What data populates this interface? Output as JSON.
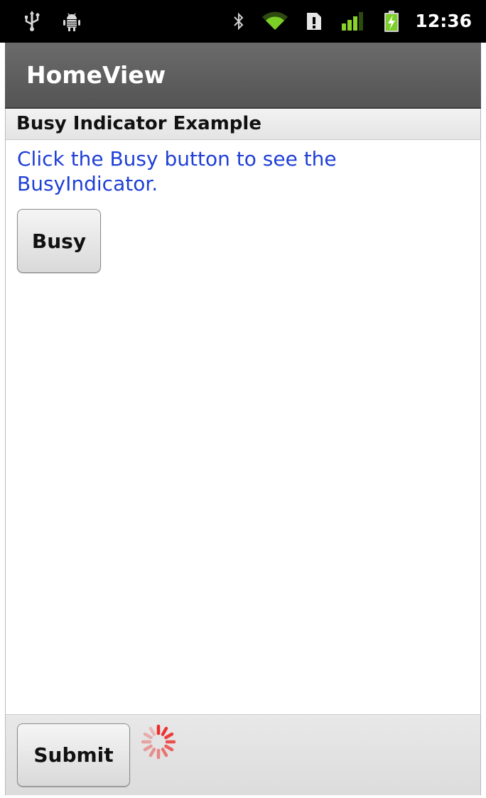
{
  "status_bar": {
    "time": "12:36",
    "icons": [
      "usb-icon",
      "android-debug-icon",
      "bluetooth-icon",
      "wifi-icon",
      "sim-alert-icon",
      "signal-icon",
      "battery-charging-icon"
    ]
  },
  "app": {
    "title": "HomeView"
  },
  "content": {
    "section_title": "Busy Indicator Example",
    "instructions": "Click the Busy button to see the BusyIndicator.",
    "busy_button_label": "Busy"
  },
  "bottom_bar": {
    "submit_label": "Submit",
    "spinner": "busy-indicator-icon"
  },
  "colors": {
    "link_blue": "#1f3fd6",
    "wifi_green": "#7ccf26",
    "signal_green": "#8ad12c",
    "spinner_red": "#ee2a2a"
  }
}
